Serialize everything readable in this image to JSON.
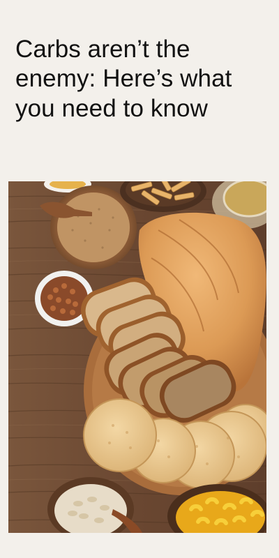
{
  "article": {
    "title": "Carbs aren’t the enemy: Here’s what you need to know",
    "image": {
      "subject": "bread-and-grains-photo",
      "items": [
        "bread-loaf",
        "sliced-bread",
        "rice-cakes",
        "pasta",
        "oats",
        "wheat-grains",
        "chickpeas"
      ]
    }
  },
  "colors": {
    "background": "#f3f0eb",
    "text": "#111111",
    "wood": "#6b4a34",
    "bread_crust": "#c98a4b",
    "bread_crumb": "#e8c79a",
    "rice_cake": "#e9c98e",
    "pasta": "#f2c21f"
  }
}
